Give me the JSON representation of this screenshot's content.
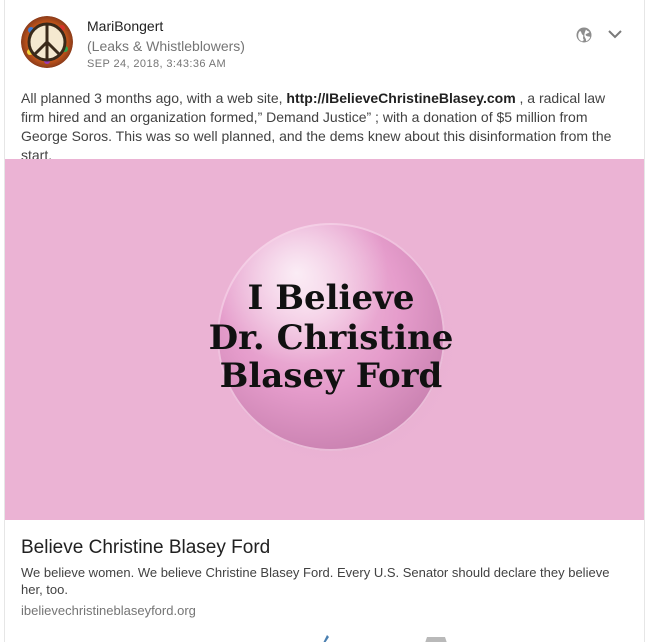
{
  "post": {
    "author": "MariBongert",
    "community": "(Leaks & Whistleblowers)",
    "timestamp": "SEP 24, 2018, 3:43:36 AM",
    "text_before": "All planned 3 months ago, with a web site, ",
    "text_link": "http://IBelieveChristineBlasey.com",
    "text_after": " , a radical law firm hired and an organization formed,” Demand Justice” ; with a donation of $5 million from George Soros. This was so well planned, and the dems knew about this disinformation from the start.",
    "icons": {
      "visibility": "globe-icon",
      "menu": "chevron-down-icon",
      "avatar": "peace-sign-icon"
    }
  },
  "image": {
    "button_line1": "I Believe",
    "button_line2": "Dr. Christine",
    "button_line3": "Blasey Ford"
  },
  "link_preview": {
    "title": "Believe Christine Blasey Ford",
    "description": "We believe women. We believe Christine Blasey Ford. Every U.S. Senator should declare they believe her, too.",
    "domain": "ibelievechristineblaseyford.org"
  },
  "colors": {
    "image_background": "#ebb3d4",
    "button_pink": "#e59ccb",
    "muted_text": "#757575"
  }
}
